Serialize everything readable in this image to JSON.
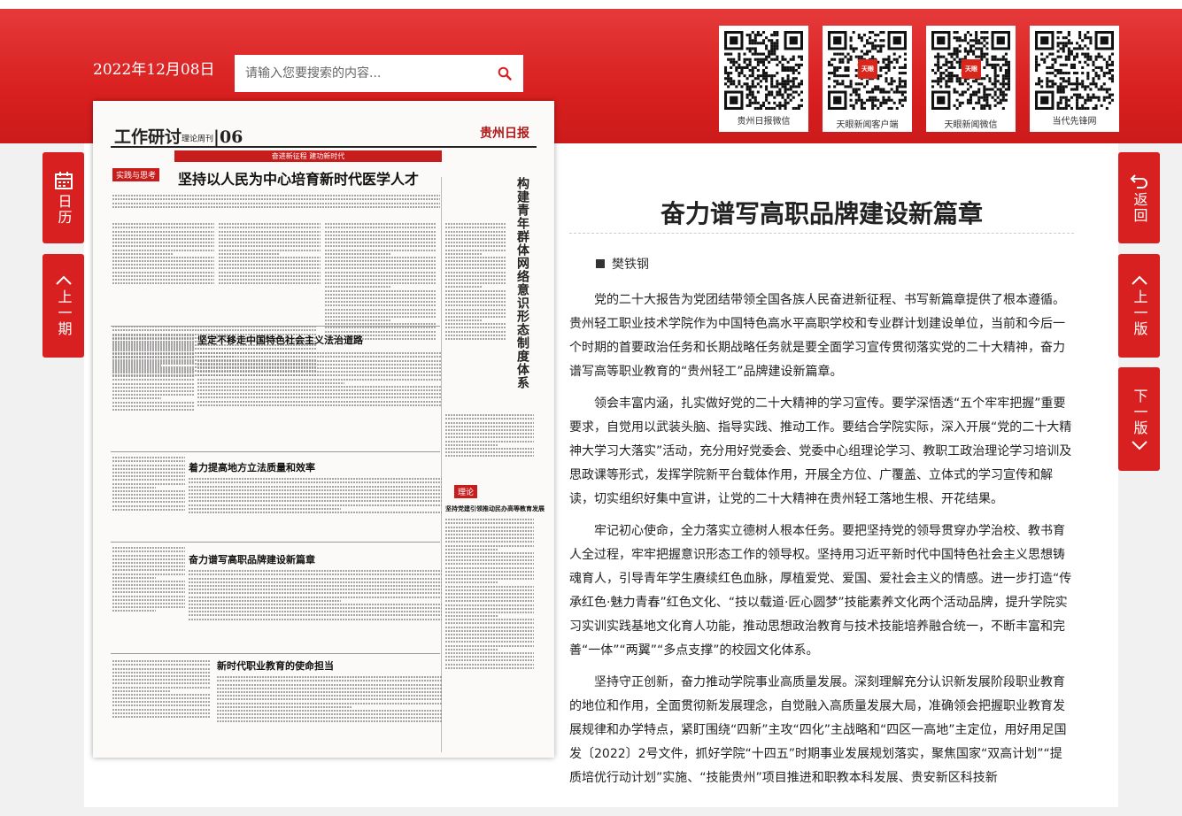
{
  "header": {
    "date": "2022年12月08日",
    "search_placeholder": "请输入您要搜索的内容...",
    "qr_codes": [
      {
        "label": "贵州日报微信",
        "badge": ""
      },
      {
        "label": "天眼新闻客户端",
        "badge": "天眼"
      },
      {
        "label": "天眼新闻微信",
        "badge": "天眼"
      },
      {
        "label": "当代先锋网",
        "badge": ""
      }
    ]
  },
  "nav": {
    "calendar_label": "日历",
    "prev_issue_label": "上一期",
    "back_label": "返回",
    "prev_page_label": "上一版",
    "next_page_label": "下一版"
  },
  "newspaper": {
    "section": "工作研讨",
    "section_sub": "理论周刊",
    "page_no": "06",
    "logo": "贵州日报",
    "banner": "奋进新征程 建功新时代",
    "tag1": "实践与思考",
    "tag2": "理论",
    "headlines": [
      "坚持以人民为中心培育新时代医学人才",
      "坚定不移走中国特色社会主义法治道路",
      "着力提高地方立法质量和效率",
      "奋力谱写高职品牌建设新篇章",
      "新时代职业教育的使命担当",
      "坚持党建引领推动民办高等教育发展"
    ],
    "vertical_title": "构建青年群体网络意识形态制度体系"
  },
  "article": {
    "title": "奋力谱写高职品牌建设新篇章",
    "author": "樊铁钢",
    "paragraphs": [
      "党的二十大报告为党团结带领全国各族人民奋进新征程、书写新篇章提供了根本遵循。贵州轻工职业技术学院作为中国特色高水平高职学校和专业群计划建设单位，当前和今后一个时期的首要政治任务和长期战略任务就是要全面学习宣传贯彻落实党的二十大精神，奋力谱写高等职业教育的“贵州轻工”品牌建设新篇章。",
      "领会丰富内涵，扎实做好党的二十大精神的学习宣传。要学深悟透“五个牢牢把握”重要要求，自觉用以武装头脑、指导实践、推动工作。要结合学院实际，深入开展“党的二十大精神大学习大落实”活动，充分用好党委会、党委中心组理论学习、教职工政治理论学习培训及思政课等形式，发挥学院新平台载体作用，开展全方位、广覆盖、立体式的学习宣传和解读，切实组织好集中宣讲，让党的二十大精神在贵州轻工落地生根、开花结果。",
      "牢记初心使命，全力落实立德树人根本任务。要把坚持党的领导贯穿办学治校、教书育人全过程，牢牢把握意识形态工作的领导权。坚持用习近平新时代中国特色社会主义思想铸魂育人，引导青年学生赓续红色血脉，厚植爱党、爱国、爱社会主义的情感。进一步打造“传承红色·魅力青春”红色文化、“技以载道·匠心圆梦”技能素养文化两个活动品牌，提升学院实习实训实践基地文化育人功能，推动思想政治教育与技术技能培养融合统一，不断丰富和完善“一体”“两翼”“多点支撑”的校园文化体系。",
      "坚持守正创新，奋力推动学院事业高质量发展。深刻理解充分认识新发展阶段职业教育的地位和作用，全面贯彻新发展理念，自觉融入高质量发展大局，准确领会把握职业教育发展规律和办学特点，紧盯围绕“四新”主攻“四化”主战略和“四区一高地”主定位，用好用足国发〔2022〕2号文件，抓好学院“十四五”时期事业发展规划落实，聚焦国家“双高计划”“提质培优行动计划”实施、“技能贵州”项目推进和职教本科发展、贵安新区科技新"
    ]
  },
  "colors": {
    "brand_red": "#d92020",
    "qr_badge": "#d9261c"
  },
  "icons": [
    "calendar-icon",
    "chevron-up-icon",
    "chevron-down-icon",
    "return-icon",
    "search-icon",
    "qr-code-icon"
  ]
}
